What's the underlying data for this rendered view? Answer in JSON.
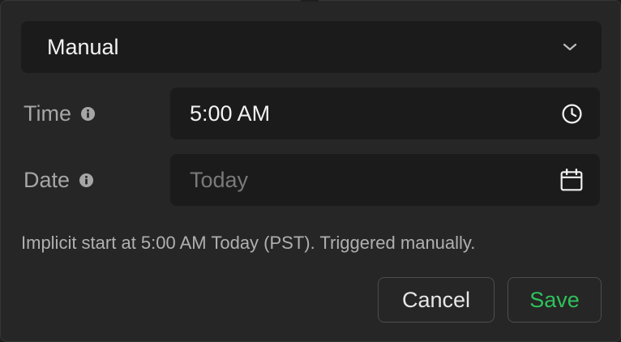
{
  "trigger_select": {
    "value": "Manual",
    "icon": "chevron-down-icon"
  },
  "time": {
    "label": "Time",
    "info_icon": "info-icon",
    "value": "5:00 AM",
    "icon": "clock-icon"
  },
  "date": {
    "label": "Date",
    "info_icon": "info-icon",
    "placeholder": "Today",
    "value": "",
    "icon": "calendar-icon"
  },
  "status_text": "Implicit start at 5:00 AM Today (PST). Triggered manually.",
  "buttons": {
    "cancel": "Cancel",
    "save": "Save"
  },
  "colors": {
    "panel_bg": "#262626",
    "field_bg": "#1b1b1b",
    "save_accent": "#2fc15a",
    "label_text": "#a6a6a6"
  }
}
